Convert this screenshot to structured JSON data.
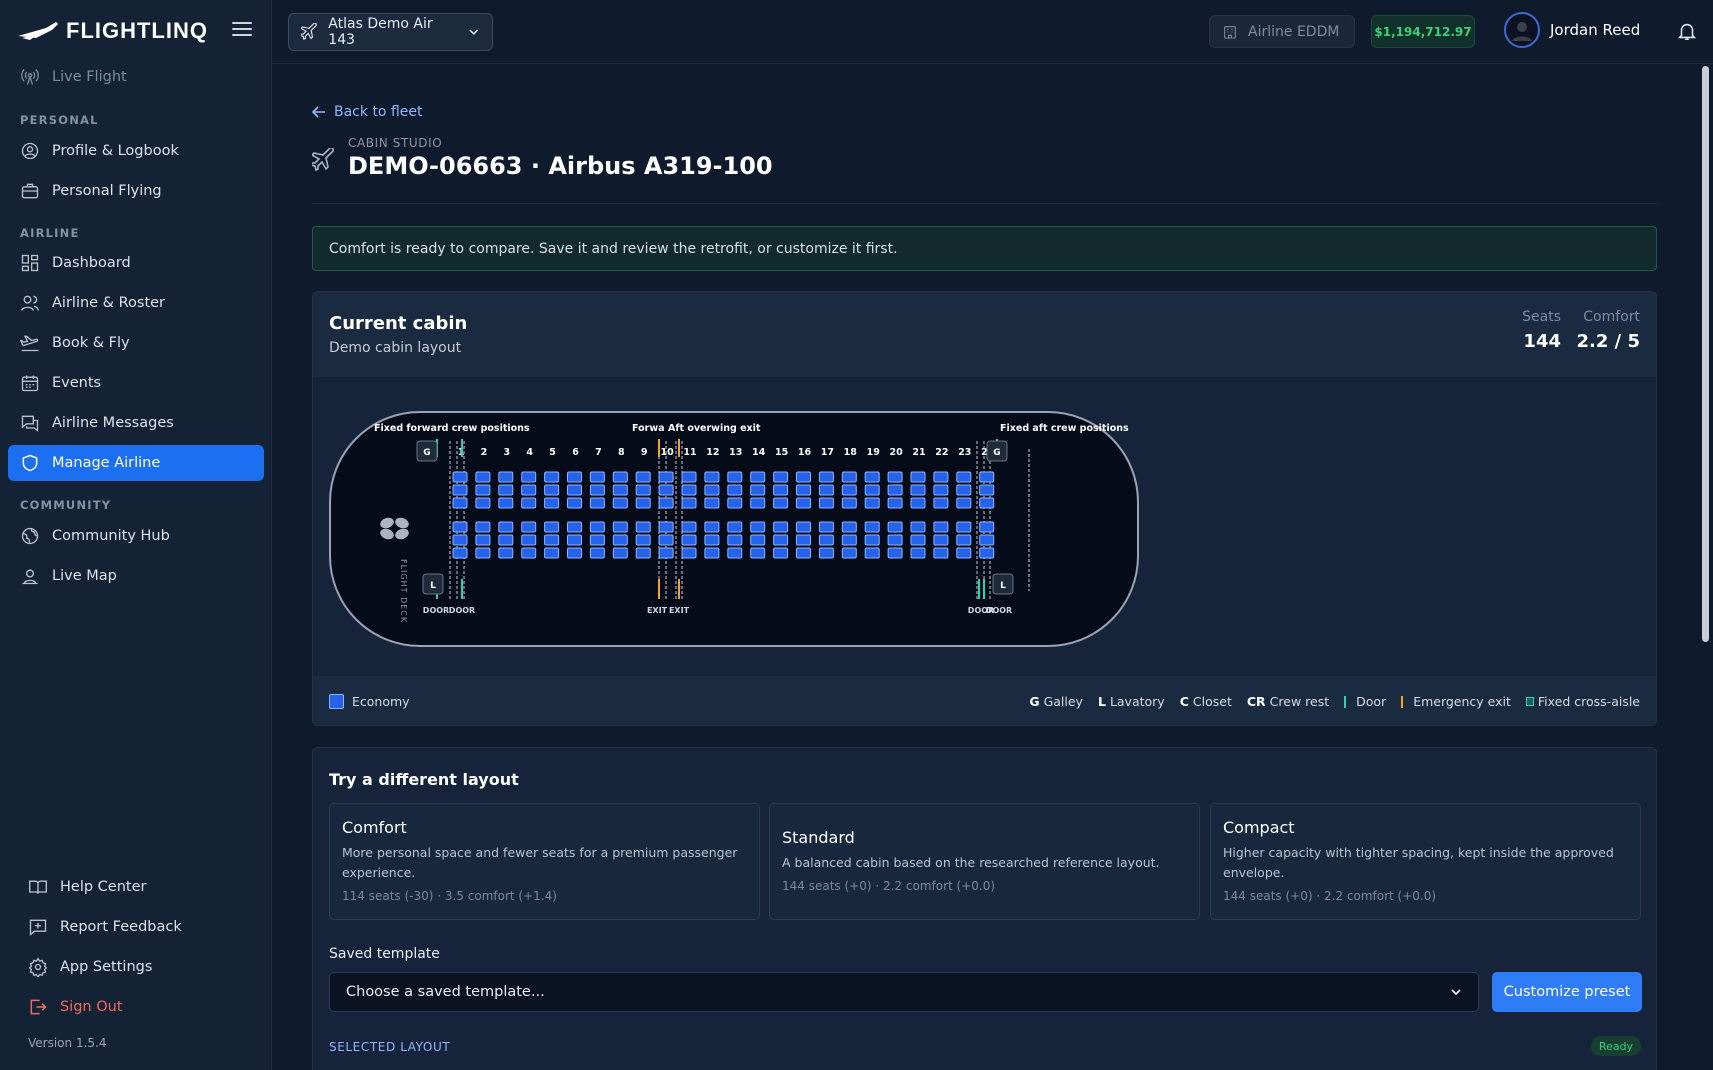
{
  "brand": {
    "name": "FLIGHTLINQ"
  },
  "sidebar": {
    "live": "Live Flight",
    "sections": {
      "personal": "PERSONAL",
      "airline": "AIRLINE",
      "community": "COMMUNITY"
    },
    "items": {
      "profile": "Profile & Logbook",
      "personal_flying": "Personal Flying",
      "dashboard": "Dashboard",
      "roster": "Airline & Roster",
      "book": "Book & Fly",
      "events": "Events",
      "messages": "Airline Messages",
      "manage": "Manage Airline",
      "hub": "Community Hub",
      "map": "Live Map"
    },
    "footer": {
      "help": "Help Center",
      "feedback": "Report Feedback",
      "settings": "App Settings",
      "signout": "Sign Out"
    },
    "version": "Version 1.5.4"
  },
  "topbar": {
    "aircraft": "Atlas Demo Air 143",
    "eddm": "Airline EDDM",
    "balance": "$1,194,712.97",
    "user": "Jordan Reed"
  },
  "page": {
    "back": "Back to fleet",
    "kicker": "CABIN STUDIO",
    "title": "DEMO-06663 · Airbus A319-100",
    "banner": "Comfort is ready to compare. Save it and review the retrofit, or customize it first."
  },
  "cabin": {
    "title": "Current cabin",
    "subtitle": "Demo cabin layout",
    "seats_label": "Seats",
    "seats": "144",
    "comfort_label": "Comfort",
    "comfort": "2.2 / 5",
    "zones": {
      "fwd": "Fixed forward crew positions",
      "fwd_exit": "Forwa",
      "aft_exit": "Aft overwing exit",
      "aft": "Fixed aft crew positions"
    },
    "flight_deck": "FLIGHT DECK",
    "rows": [
      "1",
      "2",
      "3",
      "4",
      "5",
      "6",
      "7",
      "8",
      "9",
      "10",
      "11",
      "12",
      "13",
      "14",
      "15",
      "16",
      "17",
      "18",
      "19",
      "20",
      "21",
      "22",
      "23",
      "24"
    ],
    "bottom_labels": {
      "door": "DOOR",
      "exit": "EXIT"
    },
    "monuments": {
      "galley": "G",
      "lav": "L"
    },
    "legend": {
      "economy": "Economy",
      "galley": "Galley",
      "lavatory": "Lavatory",
      "closet": "Closet",
      "crewrest": "Crew rest",
      "door": "Door",
      "emergency": "Emergency exit",
      "cross_aisle": "Fixed cross-aisle",
      "keys": {
        "g": "G",
        "l": "L",
        "c": "C",
        "cr": "CR"
      }
    },
    "colors": {
      "seat": "#2563eb",
      "door": "#2dd4a8",
      "exit": "#f5a524"
    }
  },
  "layouts": {
    "title": "Try a different layout",
    "options": [
      {
        "name": "Comfort",
        "desc": "More personal space and fewer seats for a premium passenger experience.",
        "meta": "114 seats (-30) · 3.5 comfort (+1.4)"
      },
      {
        "name": "Standard",
        "desc": "A balanced cabin based on the researched reference layout.",
        "meta": "144 seats (+0) · 2.2 comfort (+0.0)"
      },
      {
        "name": "Compact",
        "desc": "Higher capacity with tighter spacing, kept inside the approved envelope.",
        "meta": "144 seats (+0) · 2.2 comfort (+0.0)"
      }
    ],
    "template_label": "Saved template",
    "template_placeholder": "Choose a saved template...",
    "customize": "Customize preset",
    "selected": "SELECTED LAYOUT",
    "ready": "Ready"
  }
}
